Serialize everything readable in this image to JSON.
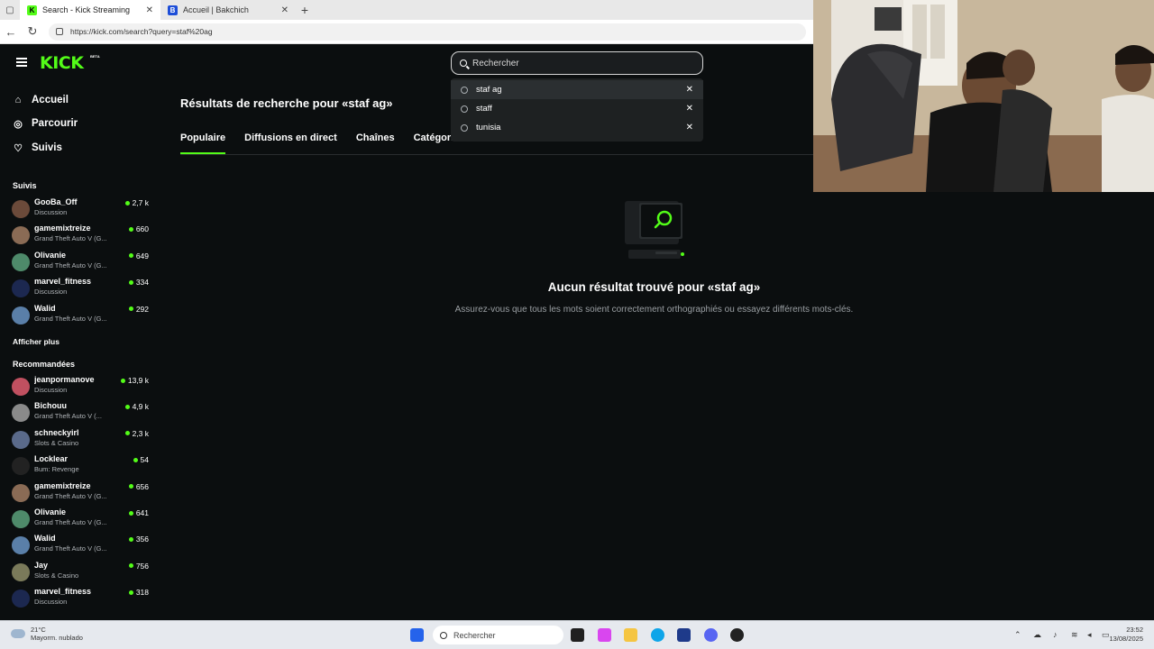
{
  "browser": {
    "tabs": [
      {
        "title": "Search - Kick Streaming",
        "favicon": "kick-favicon"
      },
      {
        "title": "Accueil | Bakchich",
        "favicon": "bakchich-favicon"
      }
    ],
    "url": "https://kick.com/search?query=staf%20ag"
  },
  "kick": {
    "logo": "KICK",
    "beta": "BETA",
    "nav": [
      {
        "label": "Accueil",
        "icon": "home-icon"
      },
      {
        "label": "Parcourir",
        "icon": "compass-icon"
      },
      {
        "label": "Suivis",
        "icon": "heart-icon"
      }
    ],
    "followed_title": "Suivis",
    "followed": [
      {
        "name": "GooBa_Off",
        "category": "Discussion",
        "viewers": "2,7 k",
        "color": "#6b4a3a"
      },
      {
        "name": "gamemixtreize",
        "category": "Grand Theft Auto V (G...",
        "viewers": "660",
        "color": "#8a6b55"
      },
      {
        "name": "Olivanie",
        "category": "Grand Theft Auto V (G...",
        "viewers": "649",
        "color": "#4e8a6a"
      },
      {
        "name": "marvel_fitness",
        "category": "Discussion",
        "viewers": "334",
        "color": "#1c2850"
      },
      {
        "name": "Walid",
        "category": "Grand Theft Auto V (G...",
        "viewers": "292",
        "color": "#5a7fa8"
      }
    ],
    "show_more": "Afficher plus",
    "recommended_title": "Recommandées",
    "recommended": [
      {
        "name": "jeanpormanove",
        "category": "Discussion",
        "viewers": "13,9 k",
        "color": "#c05060"
      },
      {
        "name": "Bichouu",
        "category": "Grand Theft Auto V (...",
        "viewers": "4,9 k",
        "color": "#8a8a8a"
      },
      {
        "name": "schneckyirl",
        "category": "Slots & Casino",
        "viewers": "2,3 k",
        "color": "#5a6a8a"
      },
      {
        "name": "Locklear",
        "category": "Bum: Revenge",
        "viewers": "54",
        "color": "#222222"
      },
      {
        "name": "gamemixtreize",
        "category": "Grand Theft Auto V (G...",
        "viewers": "656",
        "color": "#8a6b55"
      },
      {
        "name": "Olivanie",
        "category": "Grand Theft Auto V (G...",
        "viewers": "641",
        "color": "#4e8a6a"
      },
      {
        "name": "Walid",
        "category": "Grand Theft Auto V (G...",
        "viewers": "356",
        "color": "#5a7fa8"
      },
      {
        "name": "Jay",
        "category": "Slots & Casino",
        "viewers": "756",
        "color": "#7a7a5a"
      },
      {
        "name": "marvel_fitness",
        "category": "Discussion",
        "viewers": "318",
        "color": "#1c2850"
      }
    ],
    "search": {
      "placeholder": "Rechercher",
      "history": [
        {
          "label": "staf ag"
        },
        {
          "label": "staff"
        },
        {
          "label": "tunisia"
        }
      ]
    },
    "results_title": "Résultats de recherche pour «staf ag»",
    "tabs": [
      "Populaire",
      "Diffusions en direct",
      "Chaînes",
      "Catégories"
    ],
    "empty": {
      "title": "Aucun résultat trouvé pour «staf ag»",
      "subtitle": "Assurez-vous que tous les mots soient correctement orthographiés ou essayez différents mots-clés."
    },
    "accent": "#53fc18"
  },
  "taskbar": {
    "weather_temp": "21°C",
    "weather_desc": "Mayorm. nublado",
    "search_placeholder": "Rechercher",
    "time": "23:52",
    "date": "13/08/2025"
  }
}
